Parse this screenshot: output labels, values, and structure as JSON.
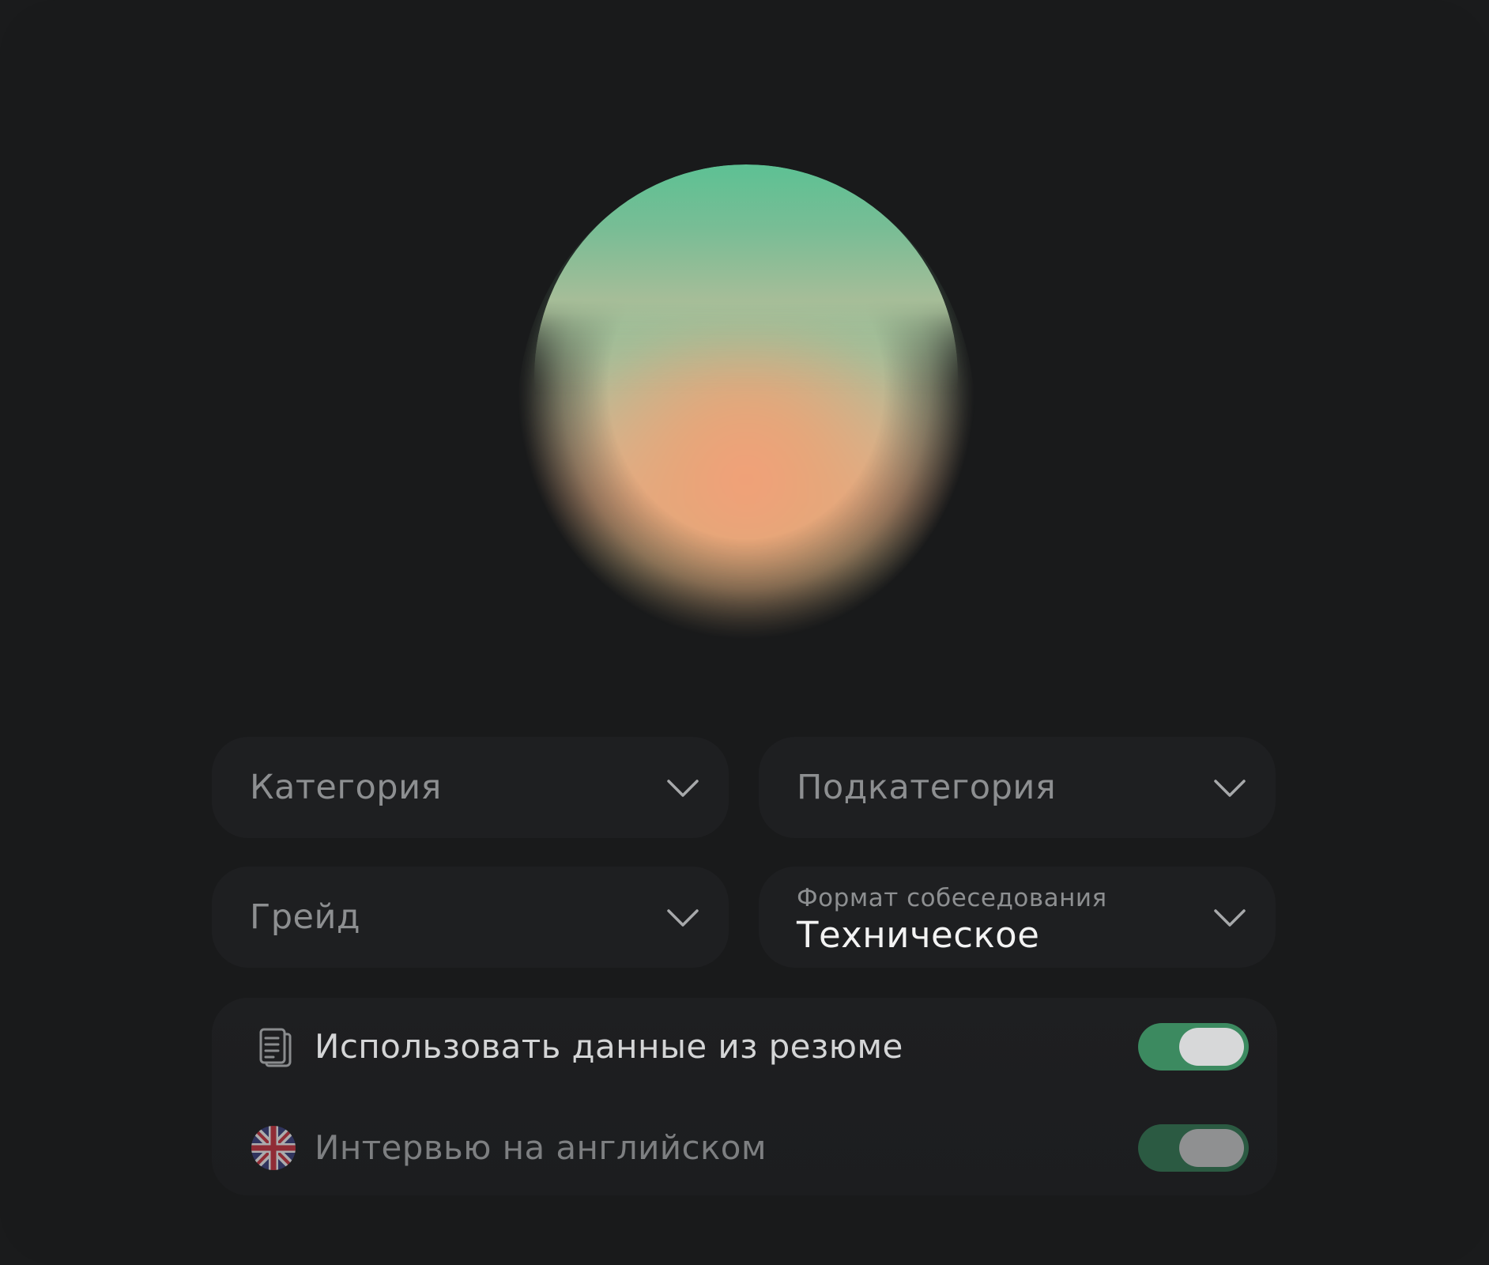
{
  "fields": {
    "category": {
      "label": "Категория"
    },
    "subcategory": {
      "label": "Подкатегория"
    },
    "grade": {
      "label": "Грейд"
    },
    "format": {
      "label": "Формат собеседования",
      "value": "Техническое"
    }
  },
  "toggles": {
    "resume": {
      "label": "Использовать данные из резюме",
      "icon": "document-icon",
      "on": true
    },
    "english": {
      "label": "Интервью на английском",
      "icon": "uk-flag-icon",
      "on": true
    }
  },
  "colors": {
    "accent": "#3f8a60",
    "background": "#191a1b",
    "field": "#1e1f21"
  }
}
